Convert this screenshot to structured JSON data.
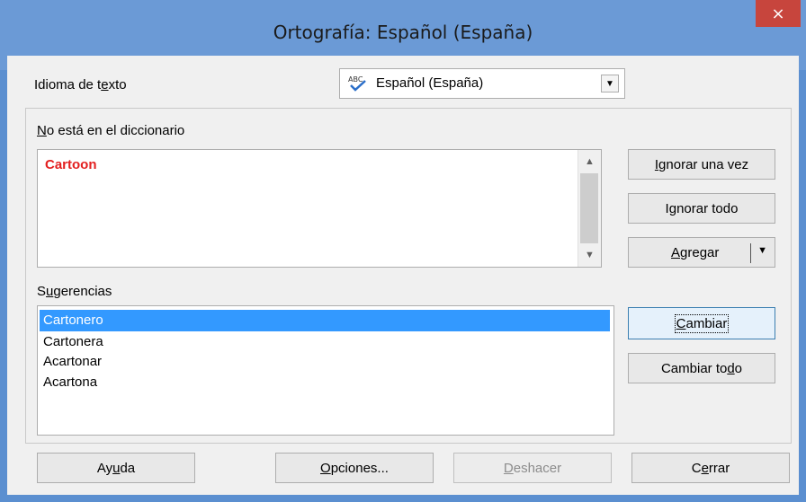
{
  "window": {
    "title": "Ortografía: Español (España)",
    "close_glyph": "×"
  },
  "language": {
    "label_pre": "Idioma de t",
    "label_key": "e",
    "label_post": "xto",
    "value": "Español (España)",
    "icon": "spellcheck-abc-icon",
    "arrow": "▼"
  },
  "not_in_dict": {
    "label_key": "N",
    "label_post": "o está en el diccionario",
    "word": "Cartoon",
    "word_color": "#e32020"
  },
  "suggestions": {
    "label_pre": "S",
    "label_key": "u",
    "label_post": "gerencias",
    "items": [
      "Cartonero",
      "Cartonera",
      "Acartonar",
      "Acartona"
    ],
    "selected_index": 0
  },
  "buttons": {
    "ignore_once": {
      "pre": "",
      "key": "I",
      "post": "gnorar una vez"
    },
    "ignore_all": {
      "pre": "I",
      "key": "g",
      "post": "norar todo"
    },
    "add": {
      "pre": "",
      "key": "A",
      "post": "gregar",
      "arrow": "▼"
    },
    "change": {
      "pre": "",
      "key": "C",
      "post": "ambiar"
    },
    "change_all": {
      "pre": "Cambiar to",
      "key": "d",
      "post": "o"
    },
    "help": {
      "pre": "Ay",
      "key": "u",
      "post": "da"
    },
    "options": {
      "pre": "",
      "key": "O",
      "post": "pciones..."
    },
    "undo": {
      "pre": "",
      "key": "D",
      "post": "eshacer"
    },
    "close": {
      "pre": "C",
      "key": "e",
      "post": "rrar"
    }
  },
  "colors": {
    "selection": "#3399ff",
    "titlebar": "#6b9ad6",
    "close": "#c7453d"
  }
}
